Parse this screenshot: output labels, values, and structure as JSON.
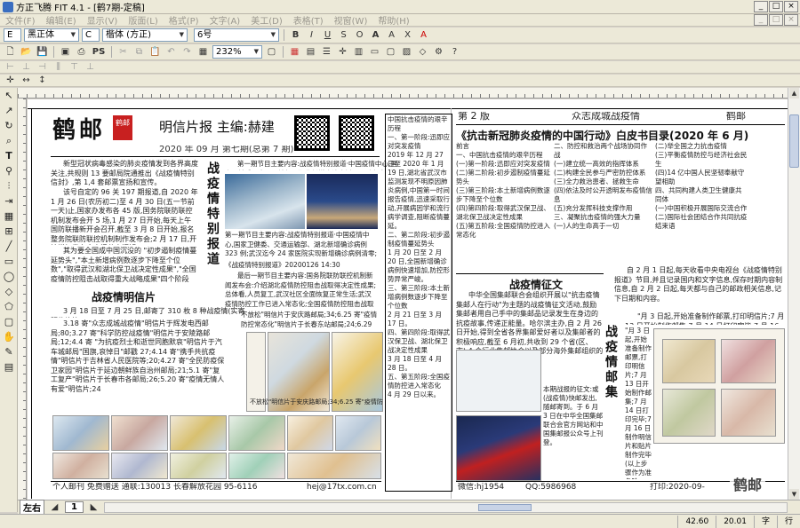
{
  "window": {
    "title": "方正飞腾 FIT 4.1 - [鹤7期-定稿]",
    "buttons": [
      "_",
      "□",
      "×"
    ]
  },
  "menu": {
    "items": [
      "文件(F)",
      "编辑(E)",
      "显示(V)",
      "版面(L)",
      "格式(P)",
      "文字(A)",
      "美工(D)",
      "表格(T)",
      "视窗(W)",
      "帮助(H)"
    ]
  },
  "toolbar_font": {
    "lang": "E",
    "font_cn": "黑正体",
    "lang2": "C",
    "font_en": "楷体 (方正)",
    "size": "6号",
    "style_buttons": [
      "B",
      "I",
      "U",
      "S",
      "O",
      "A",
      "A",
      "X",
      "A"
    ]
  },
  "toolbar_main": {
    "ps_label": "PS",
    "zoom": "232%"
  },
  "page_header": {
    "logo": "鹤邮",
    "logo_seal": "鹤邮",
    "title": "明信片报 主编:赫建",
    "issue": "2020 年 09 月 第七期(总第 7 期)",
    "section_page": "第 2 版",
    "section_title": "众志成城战疫情",
    "section_brand": "鹤邮"
  },
  "articles": {
    "intro": "新型冠状病毒感染的肺炎疫情发到各界高度关注,共规则 13 要邮局院通推出《战疫情特别信封》,第 1,4 套邮票宣扬和宣传。",
    "intro2": "该号自定的 96 关 197 期报道,自 2020 年 1 月 26 日(农历初二)至 4 月 30 日(五一节前一天)止,国家办发布各 45 版,国务院联防联控机制发布会开 5 场,1 月 27 日开始,每天上午国防联播新开会召开,截至 3 月 8 日开始,报名整务院联防联控机制制作发布会;2 月 17 日,开始增加发布会直播分享调解。",
    "intro3": "其为要全国成中国沉没的 \"初步遏制疫情蔓延势头\",\"本土新增病例数逐步下降至个位数\",\"取得武汉和湖北保卫战决定性成果\",\"全国疫情防控阻击战取得重大战略成果\"四个阶段中。",
    "sec1_title": "战疫情明信片",
    "sec1_body": "3 月 18 日至 7 月 25 日,邮寄了 310 枚 8 种战疫情(实寄明信片等)。",
    "sec1_body2": "3.18 寄\"众志成城战疫情\"明信片于辉发电西邮局;80;3.27 寄\"科学防控战疫情\"明信片于安陵路邮局;12;4.4 寄 \"为抗疫烈士和逝世同胞默哀\"明信片于汽车城邮局\"国旗,哀悼日\"邮戳 27;4.14 寄\"携手共抗疫情\"明信片于吉林省人民医院等;20;4.27 寄\"全民防疫保卫家园\"明信片于延边朝鲜族自治州邮局;21;5.1 寄\"复工复产\"明信片于长春市各邮局;26;5.20 寄\"疫情无情人有爱\"明信片;24",
    "sec1_vertical": "战疫情特别报道",
    "center_body": "第一期节目主要内容:战疫情特别报道·中国疫情中心,国家卫健委、交通运输部、湖北新增确诊病例 323 例;武汉迄今 24 家医院实现新增确诊病例清零;武汉第 80 位战疫一线医务工作者写在离开武汉前;方舱医院的故事;火神山医院;中国新闻发布会报道;24 个省份连续多日无新增确诊病例。",
    "center_body2": "《战疫情特别报道》20200126 14:30",
    "center_body3": "最后一期节目主要内容:国务院联防联控机制新闻发布会:介绍湖北疫情防控阻击战取得决定性成果;总体看,人员复工,武汉社区全面恢复正常生活;武汉疫情防控工作已进入常态化;全国疫情防控阻击战取得重大战略成果。《战疫情特别报道》20200430 15:00",
    "center_body4": "不放松\"明信片于安庆路邮局;34;6.25 寄\"疫情防控常态化\"明信片于长春东站邮局;24;6.29 寄\"同心抗疫\"明信片于汽车城邮局,我们保卫人民健康\"明信片于汽车城邮局;24。",
    "col_strip": "中国抗击疫情的艰辛历程\n一、第一阶段:迅即应对突发疫情\n2019 年 12 月 27 日至 2020 年 1 月 19 日,湖北省武汉市监测发现不明原因肺炎病例,中国第一时间报告疫情,迅速采取行动,开展病因学和流行病学调查,阻断疫情蔓延。\n二、第二阶段:初步遏制疫情蔓延势头\n1 月 20 日至 2 月 20 日,全国新增确诊病例快速增加,防控形势异常严峻。\n三、第三阶段:本土新增病例数逐步下降至个位数\n2 月 21 日至 3 月 17 日。\n四、第四阶段:取得武汉保卫战、湖北保卫战决定性成果\n3 月 18 日至 4 月 28 日。\n五、第五阶段:全国疫情防控进入常态化\n4 月 29 日以来。",
    "book_title": "《抗击新冠肺炎疫情的中国行动》白皮书目录(2020 年 6 月)",
    "book_toc": "前言\n一、中国抗击疫情的艰辛历程\n(一)第一阶段:迅即应对突发疫情\n(二)第二阶段:初步遏制疫情蔓延势头\n(三)第三阶段:本土新增病例数逐步下降至个位数\n(四)第四阶段:取得武汉保卫战、湖北保卫战决定性成果\n(五)第五阶段:全国疫情防控进入常态化",
    "book_toc2": "二、防控和救治两个战场协同作战\n(一)建立统一高效的指挥体系\n(二)构建全民参与严密防控体系\n(三)全力救治患者、拯救生命\n(四)依法及时公开透明发布疫情信息\n(五)充分发挥科技支撑作用\n三、凝聚抗击疫情的强大力量\n(一)人的生命高于一切",
    "book_toc3": "(二)举全国之力抗击疫情\n(三)平衡疫情防控与经济社会民生\n(四)14 亿中国人民坚韧奉献守望相助\n四、共同构建人类卫生健康共同体\n(一)中国积极开展国际交流合作\n(二)国际社会团结合作共同抗疫\n结束语",
    "stamp_title": "战疫情征文",
    "stamp_body": "中华全国集邮联合会组织开展以\"抗击疫情 集邮人在行动\"为主题的战疫情征文活动,鼓励集邮者用自己手中的集邮品记录发生在身边的抗疫故事,传递正能量。哈尔滨主办,自 2 月 26 日开始,得到全省各界集邮爱好者以及集邮者的积极响应,截至 6 月初,共收到 29 个省(区、市),4 个行业集邮协会以及部分海外集邮组织的投稿征文 854 篇。",
    "stamp_body2": "本期战报的征文:或(战疫情)快邮发出,随邮寄到。于 6 月 3 日在中华全国集邮联合会官方网站和中国集邮报公众号上刊登。",
    "right_body": "自 2 月 1 日起,每天收看中央电视台《战疫情特别报道》节目,并且记录国内和文字信息,保存时期内容制信息,自 2 月 2 日起,每天都与自己的邮政相关信息,记下日期和内容。",
    "right_body2": "\"月 3 日起,开始准备制作邮票,打印明信片;7 月 13 日开始制作邮集;7 月 14 日打印完毕;7 月 16 日制作明信片和贴片制作完毕(以上步骤作为准备阶段)。从 7 月 25 日~8 月 24 日每天制作完成邮集,并于 8 月 25 日完成。",
    "right_vertical": "战疫情邮集",
    "footer_left": "个人邮刊 免费赠送 通联:130013 长春解放花园 95-6116",
    "footer_email": "hej@17tx.com.cn",
    "footer_wechat": "微信:hj1954",
    "footer_qq": "QQ:5986968",
    "footer_print": "打印:2020-09-",
    "wechat_watermark": "鹤邮"
  },
  "bottom": {
    "leftright": "左右",
    "page_num": "1"
  },
  "status": {
    "x": "42.60",
    "y": "20.01",
    "unit": "字",
    "mode": "行"
  }
}
